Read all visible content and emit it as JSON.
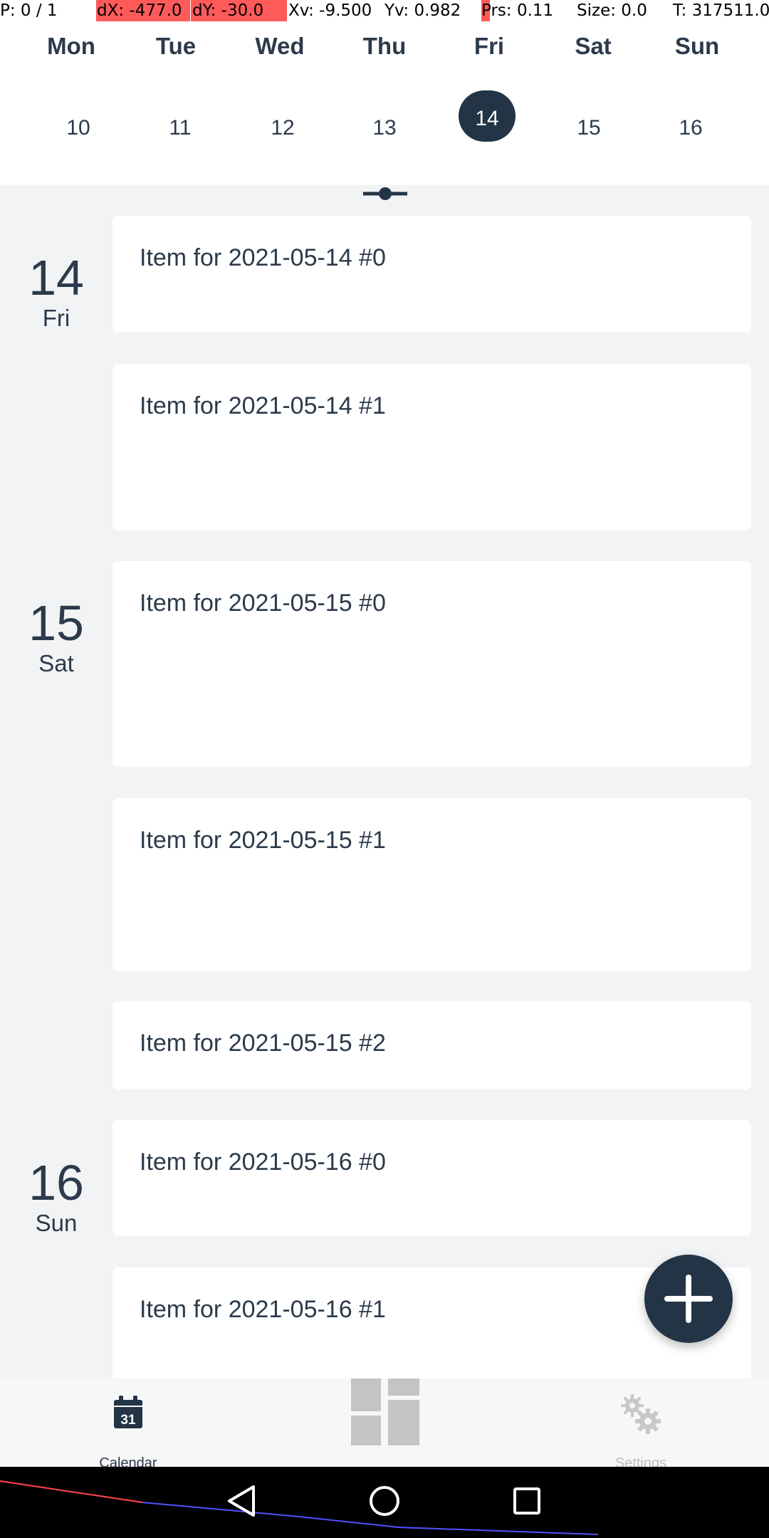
{
  "debug": {
    "pointer": "P: 0 / 1",
    "dx": "dX: -477.0",
    "dy": "dY: -30.0",
    "xv": "Xv: -9.500",
    "yv": "Yv: 0.982",
    "prs": "Prs: 0.11",
    "size": "Size: 0.0",
    "t": "T: 317511.0"
  },
  "week": {
    "days": [
      "Mon",
      "Tue",
      "Wed",
      "Thu",
      "Fri",
      "Sat",
      "Sun"
    ],
    "dates": [
      "10",
      "11",
      "12",
      "13",
      "14",
      "15",
      "16"
    ],
    "selected_index": 4
  },
  "agenda": {
    "groups": [
      {
        "day": "14",
        "weekday": "Fri"
      },
      {
        "day": "15",
        "weekday": "Sat"
      },
      {
        "day": "16",
        "weekday": "Sun"
      }
    ],
    "items": [
      "Item for 2021-05-14 #0",
      "Item for 2021-05-14 #1",
      "Item for 2021-05-15 #0",
      "Item for 2021-05-15 #1",
      "Item for 2021-05-15 #2",
      "Item for 2021-05-16 #0",
      "Item for 2021-05-16 #1"
    ]
  },
  "fab": {
    "icon": "plus-icon"
  },
  "bottom_nav": {
    "calendar": {
      "label": "Calendar",
      "icon": "calendar-icon",
      "icon_text": "31"
    },
    "middle": {
      "icon": "dashboard-icon"
    },
    "settings": {
      "label": "Settings",
      "icon": "gear-icon"
    }
  },
  "colors": {
    "accent": "#243447",
    "text": "#2c3a4b",
    "background": "#f2f3f5",
    "card": "#ffffff",
    "debug_highlight": "#ff5a5a",
    "nav_inactive": "#c0c0c0"
  }
}
